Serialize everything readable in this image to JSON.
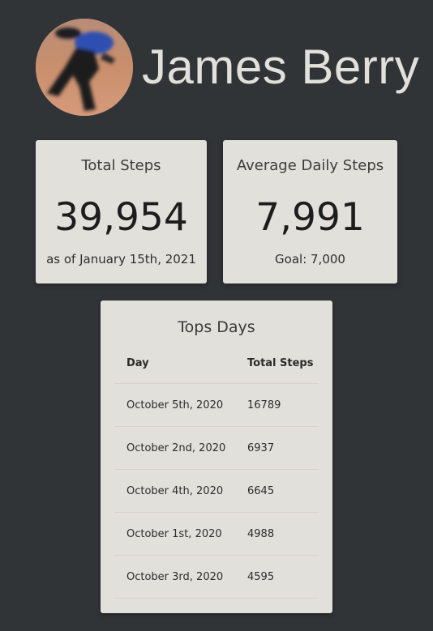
{
  "profile": {
    "name": "James Berry",
    "avatar_icon": "person-running-photo"
  },
  "stats": {
    "total": {
      "title": "Total Steps",
      "value": "39,954",
      "subtitle": "as of January 15th, 2021"
    },
    "average": {
      "title": "Average Daily Steps",
      "value": "7,991",
      "subtitle": "Goal: 7,000"
    }
  },
  "top_days": {
    "title": "Tops Days",
    "columns": [
      "Day",
      "Total Steps"
    ],
    "rows": [
      {
        "day": "October 5th, 2020",
        "steps": "16789"
      },
      {
        "day": "October 2nd, 2020",
        "steps": "6937"
      },
      {
        "day": "October 4th, 2020",
        "steps": "6645"
      },
      {
        "day": "October 1st, 2020",
        "steps": "4988"
      },
      {
        "day": "October 3rd, 2020",
        "steps": "4595"
      }
    ]
  },
  "colors": {
    "background": "#313437",
    "card": "#e2e0da",
    "name_text": "#e2e0db"
  }
}
